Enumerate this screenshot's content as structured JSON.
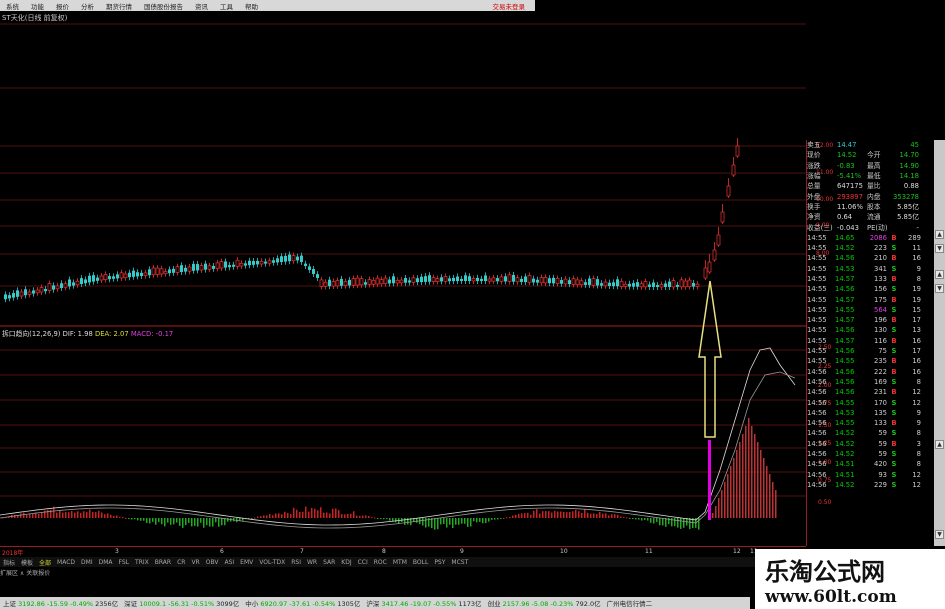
{
  "menu": {
    "items": [
      "系统",
      "功能",
      "报价",
      "分析",
      "期货行情",
      "国债股份报告",
      "资讯",
      "工具",
      "帮助"
    ],
    "right_text": "交易未登录"
  },
  "window_title": "ST天化(日线 前复权)",
  "macd_label": {
    "name": "拆口趋向(12,26,9)",
    "dif": "DIF: 1.98",
    "dea": "DEA: 2.07",
    "macd": "MACD: -0.17"
  },
  "price_axis": [
    "12.00",
    "11.00",
    "10.00",
    "9.00",
    "8.00"
  ],
  "macd_axis": [
    "2.50",
    "2.25",
    "2.00",
    "1.75",
    "1.50",
    "1.25",
    "1.00",
    "0.75",
    "0.50"
  ],
  "quote_panel": [
    {
      "a": "卖五",
      "b": "14.47",
      "c": "",
      "d": "45"
    },
    {
      "a": "现价",
      "b": "14.52",
      "c": "今开",
      "d": "14.70"
    },
    {
      "a": "涨跌",
      "b": "-0.83",
      "c": "最高",
      "d": "14.90"
    },
    {
      "a": "涨幅",
      "b": "-5.41%",
      "c": "最低",
      "d": "14.18"
    },
    {
      "a": "总量",
      "b": "647175",
      "c": "量比",
      "d": "0.88"
    },
    {
      "a": "外盘",
      "b": "293897",
      "c": "内盘",
      "d": "353278"
    },
    {
      "a": "换手",
      "b": "11.06%",
      "c": "股本",
      "d": "5.85亿"
    },
    {
      "a": "净资",
      "b": "0.64",
      "c": "流通",
      "d": "5.85亿"
    },
    {
      "a": "收益(三)",
      "b": "-0.043",
      "c": "PE(动)",
      "d": "-"
    }
  ],
  "ticks": [
    {
      "t": "14:55",
      "p": "14.65",
      "v": "2086",
      "s": "B",
      "n": "289"
    },
    {
      "t": "14:55",
      "p": "14.52",
      "v": "223",
      "s": "S",
      "n": "11"
    },
    {
      "t": "14:55",
      "p": "14.56",
      "v": "210",
      "s": "B",
      "n": "16"
    },
    {
      "t": "14:55",
      "p": "14.53",
      "v": "341",
      "s": "S",
      "n": "9"
    },
    {
      "t": "14:55",
      "p": "14.57",
      "v": "133",
      "s": "B",
      "n": "8"
    },
    {
      "t": "14:55",
      "p": "14.56",
      "v": "156",
      "s": "S",
      "n": "19"
    },
    {
      "t": "14:55",
      "p": "14.57",
      "v": "175",
      "s": "B",
      "n": "19"
    },
    {
      "t": "14:55",
      "p": "14.55",
      "v": "564",
      "s": "S",
      "n": "15"
    },
    {
      "t": "14:55",
      "p": "14.57",
      "v": "196",
      "s": "B",
      "n": "17"
    },
    {
      "t": "14:55",
      "p": "14.56",
      "v": "130",
      "s": "S",
      "n": "13"
    },
    {
      "t": "14:55",
      "p": "14.57",
      "v": "116",
      "s": "B",
      "n": "16"
    },
    {
      "t": "14:55",
      "p": "14.56",
      "v": "75",
      "s": "S",
      "n": "17"
    },
    {
      "t": "14:55",
      "p": "14.55",
      "v": "235",
      "s": "B",
      "n": "16"
    },
    {
      "t": "14:56",
      "p": "14.56",
      "v": "222",
      "s": "B",
      "n": "16"
    },
    {
      "t": "14:56",
      "p": "14.56",
      "v": "169",
      "s": "S",
      "n": "8"
    },
    {
      "t": "14:56",
      "p": "14.56",
      "v": "231",
      "s": "B",
      "n": "12"
    },
    {
      "t": "14:56",
      "p": "14.55",
      "v": "170",
      "s": "S",
      "n": "12"
    },
    {
      "t": "14:56",
      "p": "14.53",
      "v": "135",
      "s": "S",
      "n": "9"
    },
    {
      "t": "14:56",
      "p": "14.55",
      "v": "133",
      "s": "B",
      "n": "9"
    },
    {
      "t": "14:56",
      "p": "14.52",
      "v": "59",
      "s": "S",
      "n": "8"
    },
    {
      "t": "14:56",
      "p": "14.52",
      "v": "59",
      "s": "B",
      "n": "3"
    },
    {
      "t": "14:56",
      "p": "14.52",
      "v": "59",
      "s": "S",
      "n": "8"
    },
    {
      "t": "14:56",
      "p": "14.51",
      "v": "420",
      "s": "S",
      "n": "8"
    },
    {
      "t": "14:56",
      "p": "14.51",
      "v": "93",
      "s": "S",
      "n": "12"
    },
    {
      "t": "14:56",
      "p": "14.52",
      "v": "229",
      "s": "S",
      "n": "12"
    }
  ],
  "date_axis": [
    "2018年",
    "3",
    "6",
    "7",
    "8",
    "9",
    "10",
    "11",
    "12",
    "11"
  ],
  "tabs": [
    "指标",
    "模板",
    "全部",
    "MACD",
    "DMI",
    "DMA",
    "FSL",
    "TRIX",
    "BRAR",
    "CR",
    "VR",
    "OBV",
    "ASI",
    "EMV",
    "VOL-TDX",
    "RSI",
    "WR",
    "SAR",
    "KDJ",
    "CCI",
    "ROC",
    "MTM",
    "BOLL",
    "PSY",
    "MCST"
  ],
  "add_bar": "扩展区 ∧ 关联报价",
  "status": [
    {
      "label": "上证",
      "val": "3192.86",
      "chg": "-15.59",
      "pct": "-0.49%",
      "amt": "2356亿"
    },
    {
      "label": "深证",
      "val": "10009.1",
      "chg": "-56.31",
      "pct": "-0.51%",
      "amt": "3099亿"
    },
    {
      "label": "中小",
      "val": "6920.97",
      "chg": "-37.61",
      "pct": "-0.54%",
      "amt": "1305亿"
    },
    {
      "label": "沪深",
      "val": "3417.46",
      "chg": "-19.07",
      "pct": "-0.55%",
      "amt": "1173亿"
    },
    {
      "label": "创业",
      "val": "2157.96",
      "chg": "-5.08",
      "pct": "-0.23%",
      "amt": "792.0亿"
    }
  ],
  "status_right": "广州电信行情二",
  "watermark": {
    "line1": "乐淘公式网",
    "line2": "www.60lt.com"
  },
  "colors": {
    "up": "#e33333",
    "down": "#1cc21c",
    "grid": "#9b1c1c",
    "highlight": "#e6e080",
    "macd_bar": "#e000e0"
  }
}
